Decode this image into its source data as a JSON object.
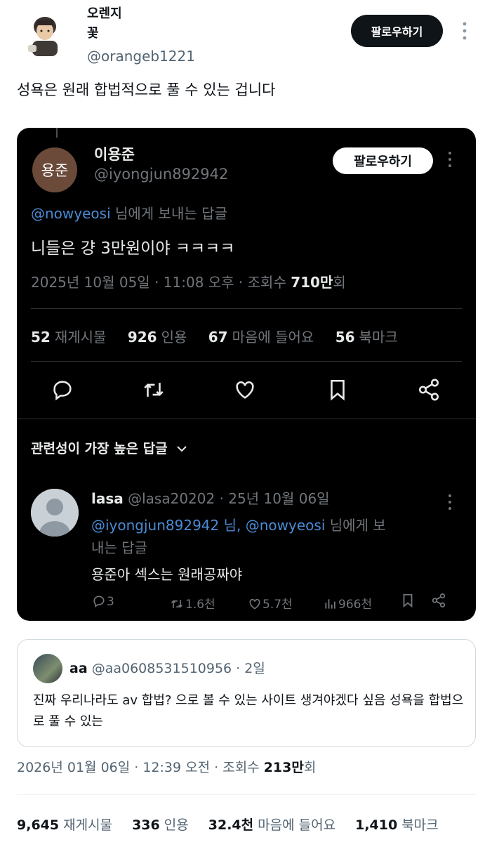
{
  "author": {
    "name_line1": "오렌지",
    "name_line2": "꽃",
    "handle": "@orangeb1221",
    "follow_label": "팔로우하기",
    "more_label": "⋮"
  },
  "tweet_text": "성욕은 원래 합법적으로 풀 수 있는 겁니다",
  "embedded": {
    "avatar_text": "용준",
    "name": "이용준",
    "handle": "@iyongjun892942",
    "follow_label": "팔로우하기",
    "reply_mention": "@nowyeosi",
    "reply_suffix": " 님에게 보내는 답글",
    "text": "니들은 걍 3만원이야 ㅋㅋㅋㅋ",
    "meta_prefix": "2025년 10월 05일 · 11:08 오후 · 조회수 ",
    "meta_views": "710만",
    "meta_suffix": "회",
    "stats": [
      {
        "count": "52",
        "label": "재게시물"
      },
      {
        "count": "926",
        "label": "인용"
      },
      {
        "count": "67",
        "label": "마음에 들어요"
      },
      {
        "count": "56",
        "label": "북마크"
      }
    ],
    "relevant_label": "관련성이 가장 높은 답글",
    "reply": {
      "name": "lasa",
      "handle_date": " @lasa20202 · 25년 10월 06일",
      "mention1": "@iyongjun892942",
      "mid": " 님, ",
      "mention2": "@nowyeosi",
      "suffix": " 님에게 보내는 답글",
      "text": "용준아 섹스는 원래공짜야",
      "replies": "3",
      "retweets": "1.6천",
      "likes": "5.7천",
      "views": "966천"
    }
  },
  "quote": {
    "name": "aa",
    "handle_time": " @aa0608531510956 · 2일",
    "text": "진짜 우리나라도 av 합법? 으로 볼 수 있는 사이트 생겨야겠다 싶음 성욕을 합법으로 풀 수 있는"
  },
  "main_meta": {
    "prefix": "2026년 01월 06일 · 12:39 오전 · 조회수 ",
    "views": "213만",
    "suffix": "회"
  },
  "main_stats": [
    {
      "count": "9,645",
      "label": "재게시물"
    },
    {
      "count": "336",
      "label": "인용"
    },
    {
      "count": "32.4천",
      "label": "마음에 들어요"
    },
    {
      "count": "1,410",
      "label": "북마크"
    }
  ]
}
